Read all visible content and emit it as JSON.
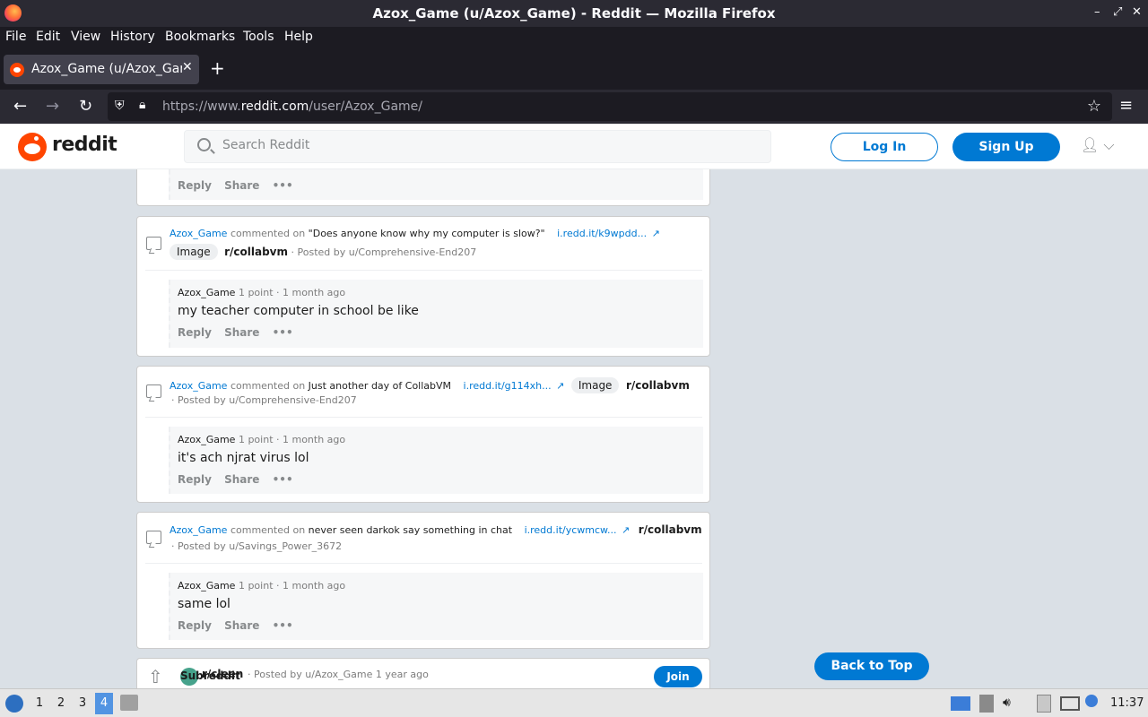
{
  "window": {
    "title": "Azox_Game (u/Azox_Game) - Reddit — Mozilla Firefox",
    "minimize": "–",
    "maximize": "⤢",
    "close": "✕"
  },
  "menu": [
    "File",
    "Edit",
    "View",
    "History",
    "Bookmarks",
    "Tools",
    "Help"
  ],
  "tab": {
    "label": "Azox_Game (u/Azox_Game)",
    "close": "✕",
    "new": "+"
  },
  "nav": {
    "back": "←",
    "forward": "→",
    "reload": "↻",
    "url_prefix": "https://www.",
    "url_domain": "reddit.com",
    "url_path": "/user/Azox_Game/",
    "menu": "≡"
  },
  "reddit": {
    "wordmark": "reddit",
    "search_placeholder": "Search Reddit",
    "login": "Log In",
    "signup": "Sign Up"
  },
  "partial_card": {
    "reply": "Reply",
    "share": "Share",
    "more": "•••"
  },
  "cards": [
    {
      "author": "Azox_Game",
      "commented_on": "commented on",
      "post_title": "\"Does anyone know why my computer is slow?\"",
      "link": "i.redd.it/k9wpdd...",
      "badge": "Image",
      "subreddit": "r/collabvm",
      "posted_by": "· Posted by u/Comprehensive-End207",
      "comment_user": "Azox_Game",
      "comment_meta": "1 point · 1 month ago",
      "comment_text": "my teacher computer in school be like",
      "reply": "Reply",
      "share": "Share",
      "more": "•••"
    },
    {
      "author": "Azox_Game",
      "commented_on": "commented on",
      "post_title": "Just another day of CollabVM",
      "link": "i.redd.it/g114xh...",
      "badge": "Image",
      "subreddit": "r/collabvm",
      "posted_by": "· Posted by u/Comprehensive-End207",
      "comment_user": "Azox_Game",
      "comment_meta": "1 point · 1 month ago",
      "comment_text": "it's ach njrat virus lol",
      "reply": "Reply",
      "share": "Share",
      "more": "•••"
    },
    {
      "author": "Azox_Game",
      "commented_on": "commented on",
      "post_title": "never seen darkok say something in chat",
      "link": "i.redd.it/ycwmcw...",
      "subreddit": "r/collabvm",
      "posted_by": "· Posted by u/Savings_Power_3672",
      "comment_user": "Azox_Game",
      "comment_meta": "1 point · 1 month ago",
      "comment_text": "same lol",
      "reply": "Reply",
      "share": "Share",
      "more": "•••"
    }
  ],
  "bottom_post": {
    "overlap_text": "Subreddit",
    "subreddit": "r/cleen",
    "posted_by": "· Posted by u/Azox_Game 1 year ago",
    "join": "Join"
  },
  "back_to_top": "Back to Top",
  "taskbar": {
    "workspaces": [
      "1",
      "2",
      "3",
      "4"
    ],
    "active_workspace": "4",
    "clock": "11:37"
  }
}
